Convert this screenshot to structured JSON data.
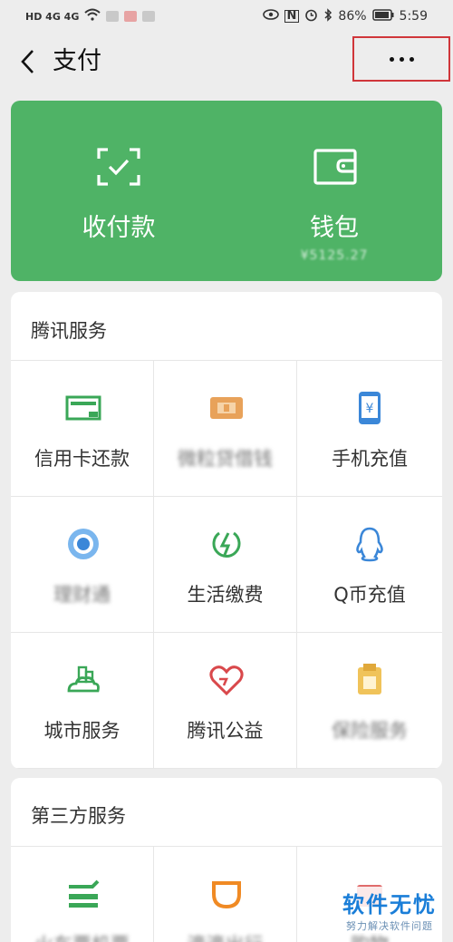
{
  "status_bar": {
    "network": "HD 4G 4G",
    "battery": "86%",
    "time": "5:59"
  },
  "header": {
    "back_icon": "back-chevron-icon",
    "title": "支付",
    "more_icon": "more-dots-icon"
  },
  "hero": {
    "color": "#4fb366",
    "items": [
      {
        "label": "收付款",
        "icon": "scan-receive-icon"
      },
      {
        "label": "钱包",
        "icon": "wallet-icon",
        "sub": "¥5125.27"
      }
    ]
  },
  "tencent_services": {
    "title": "腾讯服务",
    "items": [
      {
        "label": "信用卡还款",
        "icon": "credit-card-icon"
      },
      {
        "label": "微粒贷借钱",
        "icon": "loan-icon"
      },
      {
        "label": "手机充值",
        "icon": "phone-topup-icon"
      },
      {
        "label": "理财通",
        "icon": "wealth-icon"
      },
      {
        "label": "生活缴费",
        "icon": "bill-pay-icon"
      },
      {
        "label": "Q币充值",
        "icon": "qq-coin-icon"
      },
      {
        "label": "城市服务",
        "icon": "city-services-icon"
      },
      {
        "label": "腾讯公益",
        "icon": "charity-icon"
      },
      {
        "label": "保险服务",
        "icon": "insurance-icon"
      }
    ]
  },
  "third_party_services": {
    "title": "第三方服务",
    "items": [
      {
        "label": "火车票机票",
        "icon": "train-ticket-icon"
      },
      {
        "label": "滴滴出行",
        "icon": "ride-hailing-icon"
      },
      {
        "label": "购物",
        "icon": "shopping-icon"
      }
    ]
  },
  "watermark": {
    "title": "软件无忧",
    "subtitle": "努力解决软件问题"
  }
}
